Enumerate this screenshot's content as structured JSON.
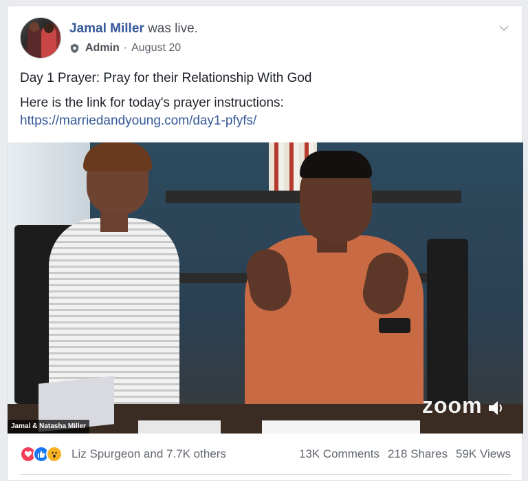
{
  "post": {
    "author": "Jamal Miller",
    "status": "was live.",
    "role": "Admin",
    "separator": "·",
    "date": "August 20",
    "text_line1": "Day 1 Prayer: Pray for their Relationship With God",
    "text_line2": "Here is the link for today's prayer instructions:",
    "link": "https://marriedandyoung.com/day1-pfyfs/"
  },
  "video": {
    "caption": "Jamal & Natasha Miller",
    "watermark": "zoom"
  },
  "footer": {
    "reactions": [
      "love-icon",
      "like-icon",
      "wow-icon"
    ],
    "reaction_summary": "Liz Spurgeon and 7.7K others",
    "comments": "13K Comments",
    "shares": "218 Shares",
    "views": "59K Views"
  },
  "colors": {
    "name_blue": "#365899",
    "love": "#f33e58",
    "like": "#1877f2",
    "wow": "#f7b125"
  }
}
